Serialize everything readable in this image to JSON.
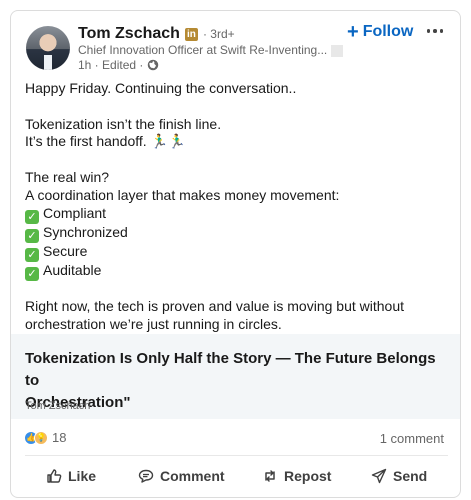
{
  "author": {
    "name": "Tom Zschach",
    "badge": "in",
    "degree": "· 3rd+",
    "headline": "Chief Innovation Officer at Swift Re-Inventing...",
    "meta": "1h · Edited ·",
    "avatar_icon": "profile-photo"
  },
  "header": {
    "follow_label": "Follow",
    "follow_prefix": "+",
    "more_icon": "ellipsis-icon"
  },
  "post": {
    "line1": "Happy Friday. Continuing the conversation..",
    "line2": "Tokenization isn’t the finish line.",
    "line3": "It’s the first handoff. 🏃‍♂️🏃‍♂️",
    "line4": "The real win?",
    "line5": "A coordination layer that makes money movement:",
    "checks": [
      "Compliant",
      "Synchronized",
      "Secure",
      "Auditable"
    ],
    "line6": "Right now, the tech is proven and value is moving but without",
    "line7": "orchestration we’re just running in circles."
  },
  "article": {
    "title_line1": "Tokenization Is Only Half the Story — The Future Belongs to",
    "title_line2": "Orchestration\"",
    "author": "Tom Zschach"
  },
  "social": {
    "reaction_count": "18",
    "comment_count": "1 comment"
  },
  "actions": {
    "like": "Like",
    "comment": "Comment",
    "repost": "Repost",
    "send": "Send"
  },
  "colors": {
    "accent": "#0a66c2",
    "check": "#57b846",
    "article_bg": "#f3f6f8"
  }
}
